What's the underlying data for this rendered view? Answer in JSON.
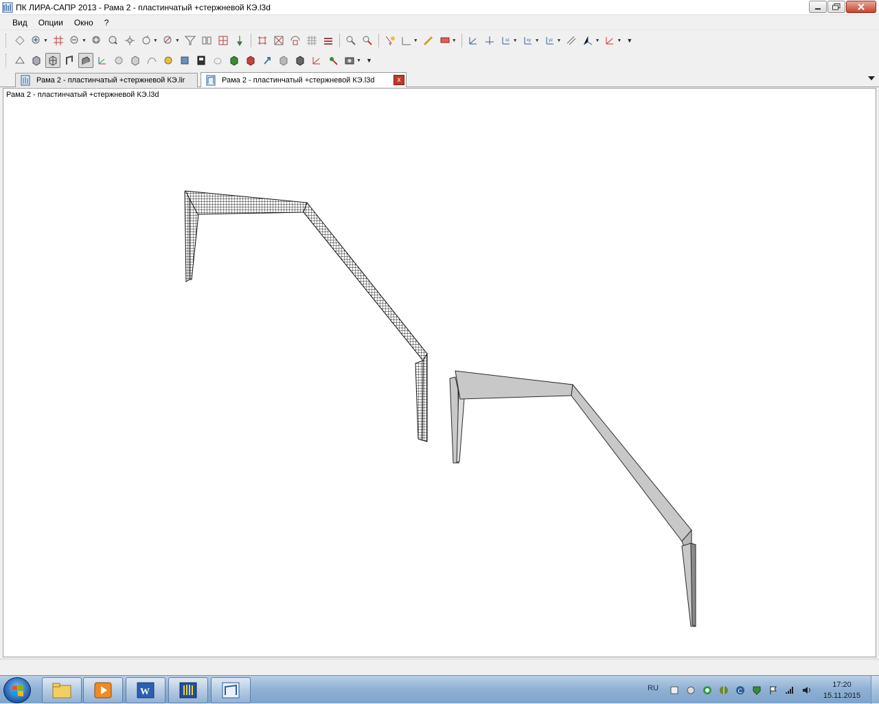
{
  "window": {
    "title": "ПК ЛИРА-САПР  2013 - Рама 2 - пластинчатый +стержневой КЭ.l3d",
    "buttons": [
      "minimize",
      "maximize",
      "close"
    ]
  },
  "menu": {
    "items": [
      "Вид",
      "Опции",
      "Окно",
      "?"
    ]
  },
  "toolbar1": {
    "icons": [
      "select-nodes-icon",
      "zoom-in-icon",
      "grid-icon",
      "zoom-out-icon",
      "zoom-window-icon",
      "zoom-all-icon",
      "pan-icon",
      "rotate-icon",
      "fragment-icon",
      "filter-icon",
      "mirror-icon",
      "mesh-icon",
      "pin-icon",
      "nodes-icon",
      "elements-icon",
      "flip-icon",
      "grid-plane-icon",
      "layers-icon",
      "search-icon",
      "find-element-icon",
      "pointer-icon",
      "axes-icon",
      "pencil-icon",
      "eraser-icon",
      "view-xz-icon",
      "view-origin-icon",
      "view-xz2-icon",
      "view-xy-icon",
      "view-yz-icon",
      "section-icon",
      "axis3d-icon",
      "axis-red-icon"
    ]
  },
  "toolbar2": {
    "icons": [
      "wireframe-icon",
      "cube-icon",
      "mesh-cube-icon",
      "profile-icon",
      "section-view-icon",
      "axes-color-icon",
      "sphere-icon",
      "shaded-cube-icon",
      "spline-icon",
      "color-sphere-icon",
      "box-icon",
      "solid-icon",
      "ring-icon",
      "green-box-icon",
      "red-box-icon",
      "arrow-icon",
      "gray-box-icon",
      "dark-box-icon",
      "axes-red-icon",
      "tool-icon",
      "camera-icon"
    ]
  },
  "tabs": [
    {
      "label": "Рама 2 - пластинчатый +стержневой КЭ.lir",
      "active": false
    },
    {
      "label": "Рама 2 - пластинчатый +стержневой КЭ.l3d",
      "active": true,
      "close_label": "x"
    }
  ],
  "document": {
    "caption": "Рама 2 - пластинчатый +стержневой КЭ.l3d"
  },
  "taskbar": {
    "apps": [
      "explorer",
      "media-player",
      "word",
      "lira-sapr",
      "lira-visor"
    ],
    "language": "RU",
    "time": "17:20",
    "date": "15.11.2015"
  },
  "colors": {
    "mesh_frame": "#1a1a1a",
    "solid_frame": "#c8c8c8",
    "solid_edge": "#2a2a2a"
  }
}
